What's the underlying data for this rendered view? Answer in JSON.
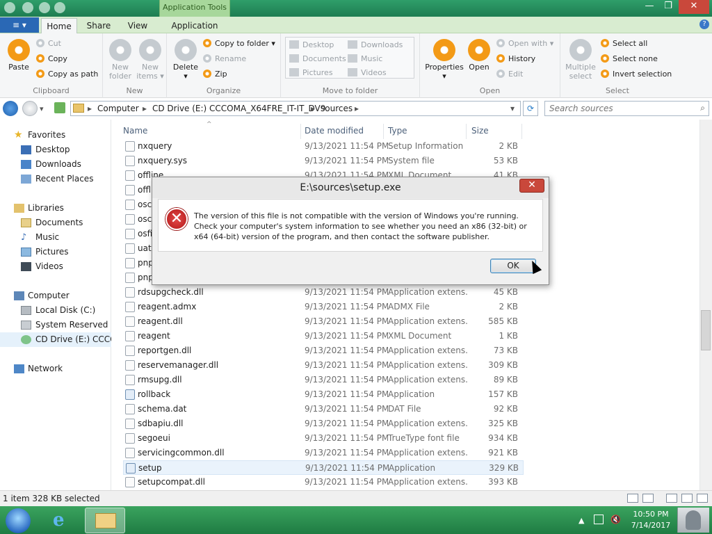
{
  "titlebar": {
    "context_tab": "Application Tools",
    "controls": [
      "—",
      "❐",
      "✕"
    ]
  },
  "tabs": {
    "file_label": "≡ ▾",
    "items": [
      "Home",
      "Share",
      "View",
      "Application"
    ],
    "active": "Home",
    "help": "?"
  },
  "ribbon": {
    "clipboard": {
      "label": "Clipboard",
      "paste": "Paste",
      "cut": "Cut",
      "copy": "Copy",
      "copy_as_path": "Copy as path"
    },
    "new": {
      "label": "New",
      "new_folder": [
        "New",
        "folder"
      ],
      "new_items": [
        "New",
        "items ▾"
      ]
    },
    "organize": {
      "label": "Organize",
      "delete": [
        "Delete",
        "▾"
      ],
      "copy_to_folder": "Copy to folder ▾",
      "rename": "Rename",
      "zip": "Zip"
    },
    "move_to_folder": {
      "label": "Move to folder",
      "items": [
        "Desktop",
        "Documents",
        "Pictures",
        "Downloads",
        "Music",
        "Videos"
      ]
    },
    "open": {
      "label": "Open",
      "properties": [
        "Properties",
        "▾"
      ],
      "open": "Open",
      "open_with": "Open with ▾",
      "history": "History",
      "edit": "Edit"
    },
    "select": {
      "label": "Select",
      "multiple_select": [
        "Multiple",
        "select"
      ],
      "select_all": "Select all",
      "select_none": "Select none",
      "invert_selection": "Invert selection"
    }
  },
  "address": {
    "crumbs": [
      "Computer",
      "▸",
      "CD Drive (E:) CCCOMA_X64FRE_IT-IT_DV9",
      "▸",
      "sources",
      "▸"
    ],
    "root_arrow": "▸",
    "dropdown": "▾",
    "refresh": "⟳",
    "search_placeholder": "Search sources",
    "search_icon": "magnifier-icon"
  },
  "nav": {
    "favorites": "Favorites",
    "desktop": "Desktop",
    "downloads": "Downloads",
    "recent_places": "Recent Places",
    "libraries": "Libraries",
    "documents": "Documents",
    "music": "Music",
    "pictures": "Pictures",
    "videos": "Videos",
    "computer": "Computer",
    "local_disk": "Local Disk (C:)",
    "system_reserved": "System Reserved (D:",
    "cd_drive": "CD Drive (E:) CCCOM",
    "network": "Network"
  },
  "columns": {
    "name": "Name",
    "date": "Date modified",
    "type": "Type",
    "size": "Size",
    "sort_indicator": "^"
  },
  "files": [
    {
      "name": "nxquery",
      "date": "9/13/2021 11:54 PM",
      "type": "Setup Information",
      "size": "2 KB"
    },
    {
      "name": "nxquery.sys",
      "date": "9/13/2021 11:54 PM",
      "type": "System file",
      "size": "53 KB"
    },
    {
      "name": "offline",
      "date": "9/13/2021 11:54 PM",
      "type": "XML Document",
      "size": "41 KB"
    },
    {
      "name": "offli",
      "date": "",
      "type": "",
      "size": ""
    },
    {
      "name": "osco",
      "date": "",
      "type": "",
      "size": ""
    },
    {
      "name": "osco",
      "date": "",
      "type": "",
      "size": ""
    },
    {
      "name": "osfil",
      "date": "",
      "type": "",
      "size": ""
    },
    {
      "name": "uato",
      "date": "",
      "type": "",
      "size": ""
    },
    {
      "name": "pnpil",
      "date": "",
      "type": "",
      "size": ""
    },
    {
      "name": "pnpp",
      "date": "",
      "type": "Application extens...",
      "size": ""
    },
    {
      "name": "rdsupgcheck.dll",
      "date": "9/13/2021 11:54 PM",
      "type": "Application extens...",
      "size": "45 KB"
    },
    {
      "name": "reagent.admx",
      "date": "9/13/2021 11:54 PM",
      "type": "ADMX File",
      "size": "2 KB"
    },
    {
      "name": "reagent.dll",
      "date": "9/13/2021 11:54 PM",
      "type": "Application extens...",
      "size": "585 KB"
    },
    {
      "name": "reagent",
      "date": "9/13/2021 11:54 PM",
      "type": "XML Document",
      "size": "1 KB"
    },
    {
      "name": "reportgen.dll",
      "date": "9/13/2021 11:54 PM",
      "type": "Application extens...",
      "size": "73 KB"
    },
    {
      "name": "reservemanager.dll",
      "date": "9/13/2021 11:54 PM",
      "type": "Application extens...",
      "size": "309 KB"
    },
    {
      "name": "rmsupg.dll",
      "date": "9/13/2021 11:54 PM",
      "type": "Application extens...",
      "size": "89 KB"
    },
    {
      "name": "rollback",
      "date": "9/13/2021 11:54 PM",
      "type": "Application",
      "size": "157 KB"
    },
    {
      "name": "schema.dat",
      "date": "9/13/2021 11:54 PM",
      "type": "DAT File",
      "size": "92 KB"
    },
    {
      "name": "sdbapiu.dll",
      "date": "9/13/2021 11:54 PM",
      "type": "Application extens...",
      "size": "325 KB"
    },
    {
      "name": "segoeui",
      "date": "9/13/2021 11:54 PM",
      "type": "TrueType font file",
      "size": "934 KB"
    },
    {
      "name": "servicingcommon.dll",
      "date": "9/13/2021 11:54 PM",
      "type": "Application extens...",
      "size": "921 KB"
    },
    {
      "name": "setup",
      "date": "9/13/2021 11:54 PM",
      "type": "Application",
      "size": "329 KB"
    },
    {
      "name": "setupcompat.dll",
      "date": "9/13/2021 11:54 PM",
      "type": "Application extens...",
      "size": "393 KB"
    }
  ],
  "status": {
    "text": "1 item 328 KB selected"
  },
  "dialog": {
    "title": "E:\\sources\\setup.exe",
    "close": "✕",
    "icon": "error-icon",
    "icon_glyph": "✕",
    "message": "The version of this file is not compatible with the version of Windows you're running. Check your computer's system information to see whether you need an x86 (32-bit) or x64 (64-bit) version of the program, and then contact the software publisher.",
    "ok": "OK"
  },
  "taskbar": {
    "time": "10:50 PM",
    "date": "7/14/2017",
    "tray_arrow": "▲"
  },
  "colors": {
    "title_green": "#1e7d52",
    "accent_orange": "#f39a16",
    "error_red": "#c21f1f",
    "taskbar_green": "#2a8f4f"
  }
}
